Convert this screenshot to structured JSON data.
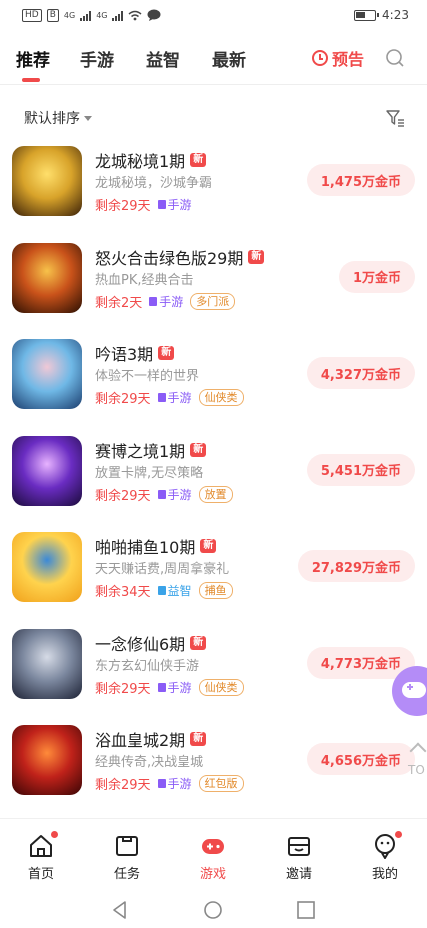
{
  "status_bar": {
    "left_chips": [
      "HD",
      "B"
    ],
    "network_labels": [
      "4G",
      "4G"
    ],
    "time": "4:23"
  },
  "tabs": [
    {
      "label": "推荐",
      "active": true
    },
    {
      "label": "手游",
      "active": false
    },
    {
      "label": "益智",
      "active": false
    },
    {
      "label": "最新",
      "active": false
    }
  ],
  "preview_label": "预告",
  "sort": {
    "label": "默认排序"
  },
  "colors": {
    "accent": "#f04a4a",
    "tag_orange": "#e28a2b",
    "category_purple": "#8a5cf6",
    "category_blue": "#3aa3e8"
  },
  "games": [
    {
      "title": "龙城秘境1期",
      "badge": "新",
      "desc": "龙城秘境，沙城争霸",
      "days": "剩余29天",
      "category": "手游",
      "category_color": "#8a5cf6",
      "tag": "",
      "reward": "1,475万金币",
      "thumb": [
        "#3a2008",
        "#d8a32a",
        "#ffdf6b"
      ]
    },
    {
      "title": "怒火合击绿色版29期",
      "badge": "新",
      "desc": "热血PK,经典合击",
      "days": "剩余2天",
      "category": "手游",
      "category_color": "#8a5cf6",
      "tag": "多门派",
      "reward": "1万金币",
      "thumb": [
        "#2a0f02",
        "#c9521a",
        "#f7c24a"
      ]
    },
    {
      "title": "吟语3期",
      "badge": "新",
      "desc": "体验不一样的世界",
      "days": "剩余29天",
      "category": "手游",
      "category_color": "#8a5cf6",
      "tag": "仙侠类",
      "reward": "4,327万金币",
      "thumb": [
        "#1b3d6e",
        "#6fb8e6",
        "#f0c8d6"
      ]
    },
    {
      "title": "赛博之境1期",
      "badge": "新",
      "desc": "放置卡牌,无尽策略",
      "days": "剩余29天",
      "category": "手游",
      "category_color": "#8a5cf6",
      "tag": "放置",
      "reward": "5,451万金币",
      "thumb": [
        "#1a0b3a",
        "#6a2cc2",
        "#e7b3ff"
      ]
    },
    {
      "title": "啪啪捕鱼10期",
      "badge": "新",
      "desc": "天天赚话费,周周拿豪礼",
      "days": "剩余34天",
      "category": "益智",
      "category_color": "#3aa3e8",
      "tag": "捕鱼",
      "reward": "27,829万金币",
      "thumb": [
        "#f0a01a",
        "#ffd34d",
        "#3b89d8"
      ]
    },
    {
      "title": "一念修仙6期",
      "badge": "新",
      "desc": "东方玄幻仙侠手游",
      "days": "剩余29天",
      "category": "手游",
      "category_color": "#8a5cf6",
      "tag": "仙侠类",
      "reward": "4,773万金币",
      "thumb": [
        "#1d2235",
        "#7b879e",
        "#d6dbe6"
      ]
    },
    {
      "title": "浴血皇城2期",
      "badge": "新",
      "desc": "经典传奇,决战皇城",
      "days": "剩余29天",
      "category": "手游",
      "category_color": "#8a5cf6",
      "tag": "红包版",
      "reward": "4,656万金币",
      "thumb": [
        "#3a0505",
        "#c0221a",
        "#ff8b3a"
      ]
    }
  ],
  "floating": {
    "top_label": "TO"
  },
  "bottom_nav": [
    {
      "label": "首页",
      "icon": "home-icon",
      "dot": true,
      "active": false
    },
    {
      "label": "任务",
      "icon": "task-icon",
      "dot": false,
      "active": false
    },
    {
      "label": "游戏",
      "icon": "game-icon",
      "dot": false,
      "active": true
    },
    {
      "label": "邀请",
      "icon": "invite-icon",
      "dot": false,
      "active": false
    },
    {
      "label": "我的",
      "icon": "profile-icon",
      "dot": true,
      "active": false
    }
  ]
}
